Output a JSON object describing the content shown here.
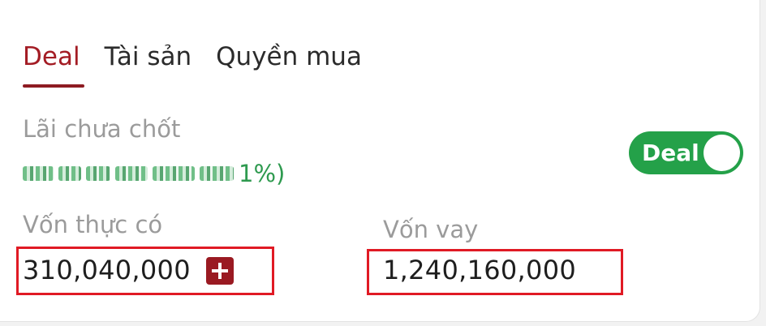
{
  "tabs": [
    {
      "label": "Deal",
      "active": true
    },
    {
      "label": "Tài sản",
      "active": false
    },
    {
      "label": "Quyền mua",
      "active": false
    }
  ],
  "unrealized": {
    "label": "Lãi chưa chốt",
    "percent_suffix": "1%)"
  },
  "toggle": {
    "label": "Deal",
    "on": true
  },
  "own_capital": {
    "label": "Vốn thực có",
    "value": "310,040,000",
    "add_icon": "plus-icon"
  },
  "loan_capital": {
    "label": "Vốn vay",
    "value": "1,240,160,000"
  },
  "colors": {
    "accent": "#a31c24",
    "toggle_on": "#24a149",
    "profit_text": "#2e9a4f",
    "highlight_box": "#e01a24"
  }
}
